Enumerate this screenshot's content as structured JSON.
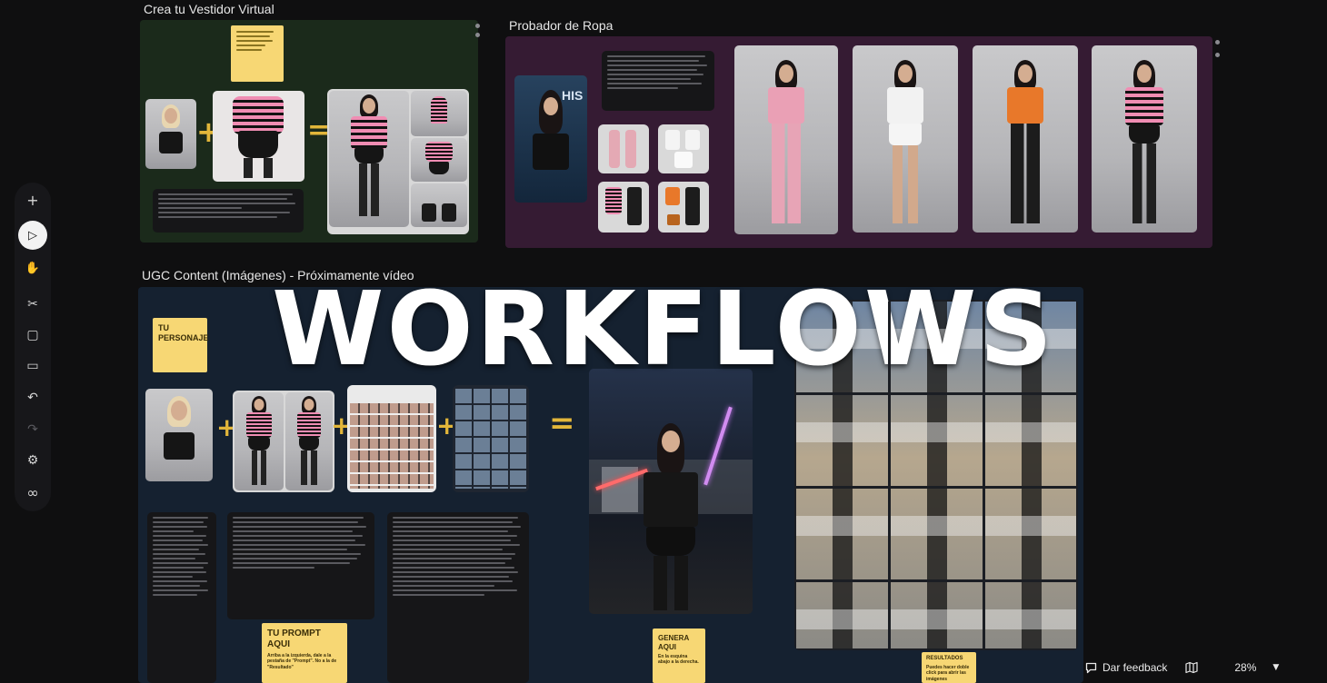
{
  "canvas": {
    "background": "#0f0f10",
    "overlay_title": "WORKFLOWS"
  },
  "groups": [
    {
      "title": "Crea tu Vestidor Virtual",
      "color": "#1b2a1b"
    },
    {
      "title": "Probador de Ropa",
      "color": "#351b33"
    },
    {
      "title": "UGC Content (Imágenes) - Próximamente vídeo",
      "color": "#152130"
    }
  ],
  "notes": {
    "personaje": "TU PERSONAJE",
    "prompt_title": "TU PROMPT AQUI",
    "prompt_body": "Arriba a la izquierda, dale a la pestaña de \"Prompt\". No a la de \"Resultado\"",
    "genera_title": "GENERA AQUI",
    "genera_body": "En la esquina abajo a la derecha.",
    "resultados_title": "RESULTADOS",
    "resultados_body": "Puedes hacer doble click para abrir las imágenes"
  },
  "operators": {
    "plus": "+",
    "equals": "="
  },
  "toolbar": {
    "items": [
      {
        "name": "add",
        "icon": "plus-icon",
        "glyph": "+"
      },
      {
        "name": "select",
        "icon": "cursor-icon",
        "glyph": "▷",
        "active": true
      },
      {
        "name": "pan",
        "icon": "hand-icon",
        "glyph": "✋"
      },
      {
        "name": "cut",
        "icon": "scissors-icon",
        "glyph": "✂"
      },
      {
        "name": "sticky-note",
        "icon": "note-icon",
        "glyph": "▢"
      },
      {
        "name": "comment",
        "icon": "comment-icon",
        "glyph": "▭"
      },
      {
        "name": "undo",
        "icon": "undo-icon",
        "glyph": "↶"
      },
      {
        "name": "redo",
        "icon": "redo-icon",
        "glyph": "↷"
      },
      {
        "name": "settings",
        "icon": "gear-icon",
        "glyph": "⚙"
      },
      {
        "name": "link",
        "icon": "link-icon",
        "glyph": "∞"
      }
    ]
  },
  "bottom_bar": {
    "feedback_label": "Dar feedback",
    "zoom": "28%"
  },
  "colors": {
    "accent_yellow": "#e2b63a",
    "note_yellow": "#f7d774",
    "pink": "#f08db3",
    "orange": "#e8782a"
  }
}
